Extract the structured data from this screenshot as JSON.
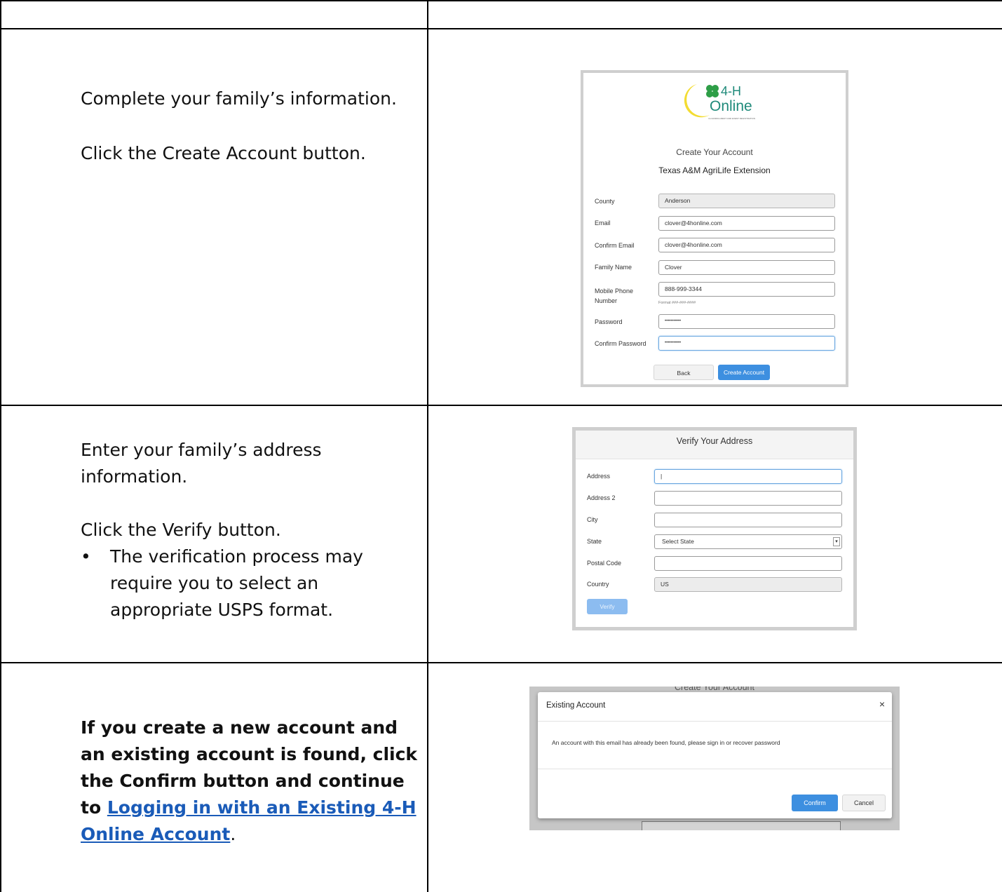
{
  "rows": [
    {
      "instructions": [
        "Complete your family’s information.",
        "Click the Create Account button."
      ],
      "create_account": {
        "logo": {
          "brand": "4-H",
          "online": "Online",
          "tagline": "4-H ENROLLMENT AND EVENT REGISTRATION"
        },
        "title": "Create Your Account",
        "subtitle": "Texas A&M AgriLife Extension",
        "fields": [
          {
            "label": "County",
            "value": "Anderson"
          },
          {
            "label": "Email",
            "value": "clover@4honline.com"
          },
          {
            "label": "Confirm Email",
            "value": "clover@4honline.com"
          },
          {
            "label": "Family Name",
            "value": "Clover"
          },
          {
            "label": "Mobile Phone Number",
            "value": "888-999-3344",
            "hint": "Format ###-###-####"
          },
          {
            "label": "Password",
            "value": "•••••••••••"
          },
          {
            "label": "Confirm Password",
            "value": "•••••••••••"
          }
        ],
        "back_label": "Back",
        "create_label": "Create Account"
      }
    },
    {
      "instructions": [
        "Enter your family’s address information.",
        "Click the Verify button."
      ],
      "bullet": "The verification process may require you to select an appropriate USPS format.",
      "verify_address": {
        "title": "Verify Your Address",
        "fields": [
          {
            "label": "Address",
            "value": "|"
          },
          {
            "label": "Address 2",
            "value": ""
          },
          {
            "label": "City",
            "value": ""
          },
          {
            "label": "State",
            "value": "Select State"
          },
          {
            "label": "Postal Code",
            "value": ""
          },
          {
            "label": "Country",
            "value": "US"
          }
        ],
        "verify_label": "Verify"
      }
    },
    {
      "instruction_bold": "If you create a new account and an existing account is found, click the Confirm button and continue to",
      "link_text": "Logging in with an Existing 4-H Online Account",
      "trailing": ".",
      "existing_account": {
        "behind_title": "Create Your Account",
        "title": "Existing Account",
        "close": "×",
        "message": "An account with this email has already been found, please sign in or recover password",
        "confirm_label": "Confirm",
        "cancel_label": "Cancel"
      }
    }
  ]
}
